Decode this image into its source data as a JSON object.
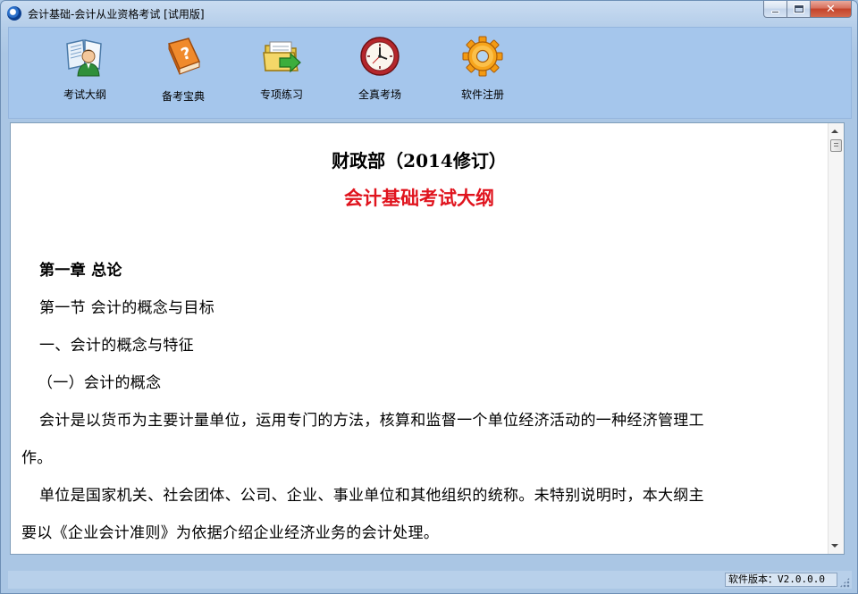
{
  "window": {
    "title": "会计基础-会计从业资格考试 [试用版]"
  },
  "toolbar": {
    "items": [
      {
        "label": "考试大纲",
        "icon": "syllabus-book-icon"
      },
      {
        "label": "备考宝典",
        "icon": "question-book-icon"
      },
      {
        "label": "专项练习",
        "icon": "folder-arrow-icon"
      },
      {
        "label": "全真考场",
        "icon": "clock-icon"
      },
      {
        "label": "软件注册",
        "icon": "gear-icon"
      }
    ]
  },
  "document": {
    "title": "财政部（2014修订）",
    "subtitle": "会计基础考试大纲",
    "subtitle_color": "#e0141e",
    "paragraphs": [
      "第一章  总论",
      "第一节  会计的概念与目标",
      "一、会计的概念与特征",
      "（一）会计的概念",
      "会计是以货币为主要计量单位，运用专门的方法，核算和监督一个单位经济活动的一种经济管理工",
      "作。",
      "单位是国家机关、社会团体、公司、企业、事业单位和其他组织的统称。未特别说明时，本大纲主",
      "要以《企业会计准则》为依据介绍企业经济业务的会计处理。"
    ]
  },
  "statusbar": {
    "version": "软件版本：V2.0.0.0"
  }
}
